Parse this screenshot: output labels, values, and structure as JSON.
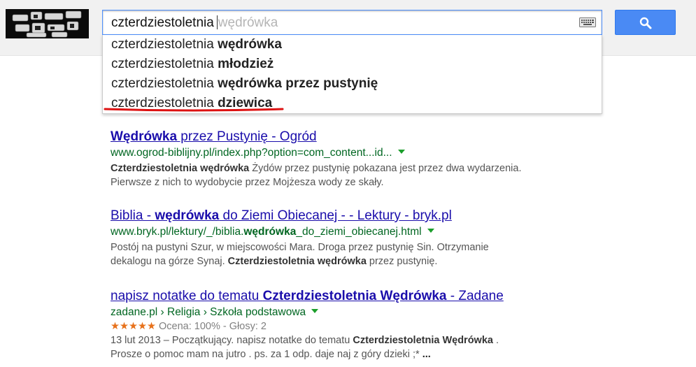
{
  "search": {
    "typed": "czterdziestoletnia",
    "completion": "wędrówka"
  },
  "suggestions": [
    {
      "prefix": "czterdziestoletnia",
      "rest": "wędrówka"
    },
    {
      "prefix": "czterdziestoletnia",
      "rest": "młodzież"
    },
    {
      "prefix": "czterdziestoletnia",
      "rest": "wędrówka przez pustynię"
    },
    {
      "prefix": "czterdziestoletnia",
      "rest": "dziewica"
    }
  ],
  "results": [
    {
      "title": [
        "Wędrówka",
        " przez Pustynię - Ogród"
      ],
      "url": "www.ogrod-biblijny.pl/index.php?option=com_content...id...",
      "snippet1": [
        "Czterdziestoletnia wędrówka",
        " Żydów przez pustynię pokazana jest przez dwa wydarzenia."
      ],
      "snippet2": "Pierwsze z nich to wydobycie przez Mojżesza wody ze skały."
    },
    {
      "title": [
        "Biblia - ",
        "wędrówka",
        " do Ziemi Obiecanej - - Lektury - bryk.pl"
      ],
      "url": [
        "www.bryk.pl/lektury/_/biblia.",
        "wędrówka",
        "_do_ziemi_obiecanej.html"
      ],
      "snippet1": "Postój na pustyni Szur, w miejscowości Mara. Droga przez pustynię Sin. Otrzymanie",
      "snippet2": [
        "dekalogu na górze Synaj. ",
        "Czterdziestoletnia wędrówka",
        " przez pustynię."
      ]
    },
    {
      "title": [
        "napisz notatke do tematu ",
        "Czterdziestoletnia Wędrówka",
        " - Zadane"
      ],
      "url": "zadane.pl › Religia › Szkoła podstawowa",
      "rating": {
        "stars": "★★★★★",
        "text": "Ocena: 100% - Głosy: 2",
        "value": 5
      },
      "snippet1": [
        "13 lut 2013 – Początkujący. napisz notatke do tematu ",
        "Czterdziestoletnia Wędrówka",
        " ."
      ],
      "snippet2": [
        "Prosze o pomoc mam na jutro . ps. za 1 odp. daje naj z góry dzieki ;* ",
        "..."
      ]
    }
  ],
  "colors": {
    "link": "#1a0dab",
    "url": "#006621",
    "search_button": "#4a8af4",
    "underline": "#dd1111"
  }
}
